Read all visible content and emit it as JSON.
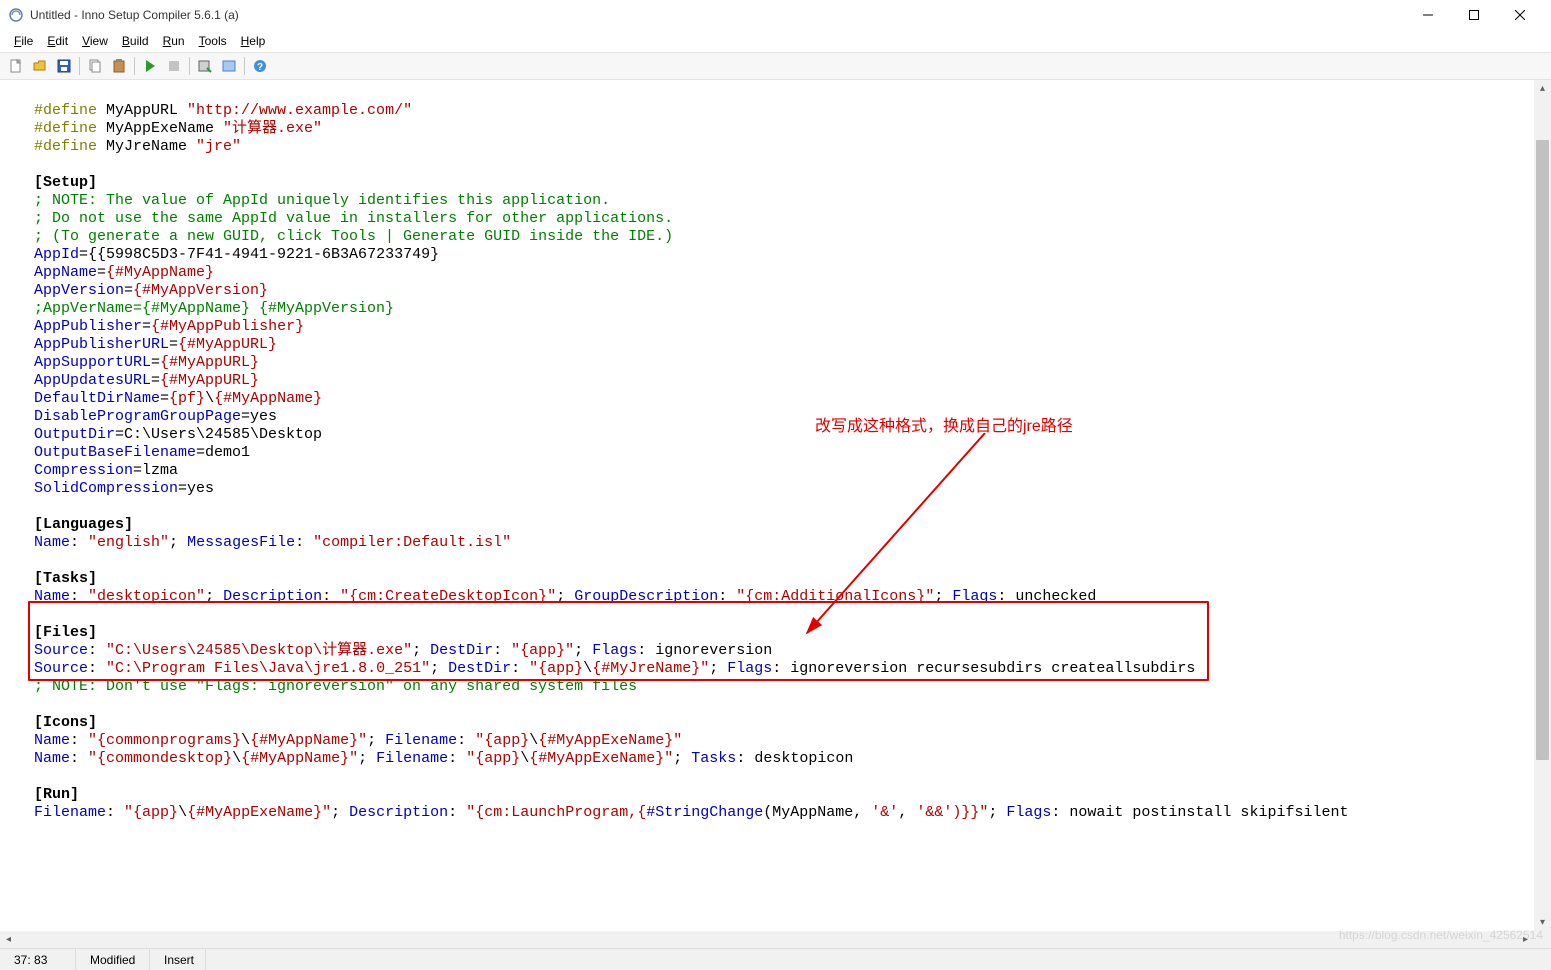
{
  "window": {
    "title": "Untitled - Inno Setup Compiler 5.6.1 (a)"
  },
  "menu": {
    "file": {
      "label": "File",
      "u": "F"
    },
    "edit": {
      "label": "Edit",
      "u": "E"
    },
    "view": {
      "label": "View",
      "u": "V"
    },
    "build": {
      "label": "Build",
      "u": "B"
    },
    "run": {
      "label": "Run",
      "u": "R"
    },
    "tools": {
      "label": "Tools",
      "u": "T"
    },
    "help": {
      "label": "Help",
      "u": "H"
    }
  },
  "annotation": {
    "text": "改写成这种格式，换成自己的jre路径"
  },
  "status": {
    "pos": "37: 83",
    "modified": "Modified",
    "insert": "Insert"
  },
  "code": {
    "l01_def": "#define",
    "l01_k": " MyAppURL ",
    "l01_s": "\"http://www.example.com/\"",
    "l02_def": "#define",
    "l02_k": " MyAppExeName ",
    "l02_s": "\"计算器.exe\"",
    "l03_def": "#define",
    "l03_k": " MyJreName ",
    "l03_s": "\"jre\"",
    "sec_setup": "[Setup]",
    "l05": "; NOTE: The value of AppId uniquely identifies this application.",
    "l06": "; Do not use the same AppId value in installers for other applications.",
    "l07": "; (To generate a new GUID, click Tools | Generate GUID inside the IDE.)",
    "l08_k": "AppId",
    "l08_v": "={{5998C5D3-7F41-4941-9221-6B3A67233749}",
    "l09_k": "AppName",
    "l09_eq": "=",
    "l09_v": "{#MyAppName}",
    "l10_k": "AppVersion",
    "l10_eq": "=",
    "l10_v": "{#MyAppVersion}",
    "l11": ";AppVerName={#MyAppName} {#MyAppVersion}",
    "l12_k": "AppPublisher",
    "l12_eq": "=",
    "l12_v": "{#MyAppPublisher}",
    "l13_k": "AppPublisherURL",
    "l13_eq": "=",
    "l13_v": "{#MyAppURL}",
    "l14_k": "AppSupportURL",
    "l14_eq": "=",
    "l14_v": "{#MyAppURL}",
    "l15_k": "AppUpdatesURL",
    "l15_eq": "=",
    "l15_v": "{#MyAppURL}",
    "l16_k": "DefaultDirName",
    "l16_eq": "=",
    "l16_v1": "{pf}",
    "l16_v2": "\\",
    "l16_v3": "{#MyAppName}",
    "l17_k": "DisableProgramGroupPage",
    "l17_v": "=yes",
    "l18_k": "OutputDir",
    "l18_v": "=C:\\Users\\24585\\Desktop",
    "l19_k": "OutputBaseFilename",
    "l19_v": "=demo1",
    "l20_k": "Compression",
    "l20_v": "=lzma",
    "l21_k": "SolidCompression",
    "l21_v": "=yes",
    "sec_lang": "[Languages]",
    "l23_k1": "Name",
    "l23_s1": "\"english\"",
    "l23_k2": "MessagesFile",
    "l23_s2": "\"compiler:Default.isl\"",
    "sec_tasks": "[Tasks]",
    "l25_k1": "Name",
    "l25_s1": "\"desktopicon\"",
    "l25_k2": "Description",
    "l25_s2a": "\"",
    "l25_s2b": "{cm:CreateDesktopIcon}",
    "l25_s2c": "\"",
    "l25_k3": "GroupDescription",
    "l25_s3a": "\"",
    "l25_s3b": "{cm:AdditionalIcons}",
    "l25_s3c": "\"",
    "l25_k4": "Flags",
    "l25_v4": ": unchecked",
    "sec_files": "[Files]",
    "l27_k1": "Source",
    "l27_s1": "\"C:\\Users\\24585\\Desktop\\计算器.exe\"",
    "l27_k2": "DestDir",
    "l27_s2a": "\"",
    "l27_s2b": "{app}",
    "l27_s2c": "\"",
    "l27_k3": "Flags",
    "l27_v3": ": ignoreversion",
    "l28_k1": "Source",
    "l28_s1": "\"C:\\Program Files\\Java\\jre1.8.0_251\"",
    "l28_k2": "DestDir",
    "l28_s2a": "\"",
    "l28_s2b": "{app}",
    "l28_s2c": "\\",
    "l28_s2d": "{#MyJreName}",
    "l28_s2e": "\"",
    "l28_k3": "Flags",
    "l28_v3": ": ignoreversion recursesubdirs createallsubdirs",
    "l29": "; NOTE: Don't use \"Flags: ignoreversion\" on any shared system files",
    "sec_icons": "[Icons]",
    "l31_k1": "Name",
    "l31_s1a": "\"",
    "l31_s1b": "{commonprograms}",
    "l31_s1c": "\\",
    "l31_s1d": "{#MyAppName}",
    "l31_s1e": "\"",
    "l31_k2": "Filename",
    "l31_s2a": "\"",
    "l31_s2b": "{app}",
    "l31_s2c": "\\",
    "l31_s2d": "{#MyAppExeName}",
    "l31_s2e": "\"",
    "l32_k1": "Name",
    "l32_s1a": "\"",
    "l32_s1b": "{commondesktop}",
    "l32_s1c": "\\",
    "l32_s1d": "{#MyAppName}",
    "l32_s1e": "\"",
    "l32_k2": "Filename",
    "l32_s2a": "\"",
    "l32_s2b": "{app}",
    "l32_s2c": "\\",
    "l32_s2d": "{#MyAppExeName}",
    "l32_s2e": "\"",
    "l32_k3": "Tasks",
    "l32_v3": ": desktopicon",
    "sec_run": "[Run]",
    "l34_k1": "Filename",
    "l34_s1a": "\"",
    "l34_s1b": "{app}",
    "l34_s1c": "\\",
    "l34_s1d": "{#MyAppExeName}",
    "l34_s1e": "\"",
    "l34_k2": "Description",
    "l34_s2a": "\"",
    "l34_s2b": "{cm:LaunchProgram,{",
    "l34_s2c": "#StringChange",
    "l34_s2d": "(MyAppName, ",
    "l34_s2e": "'&'",
    "l34_s2f": ", ",
    "l34_s2g": "'&&'",
    "l34_s2h": ")}}",
    "l34_s2i": "\"",
    "l34_k3": "Flags",
    "l34_v3": ": nowait postinstall skipifsilent"
  },
  "watermark": "https://blog.csdn.net/weixin_42562514"
}
